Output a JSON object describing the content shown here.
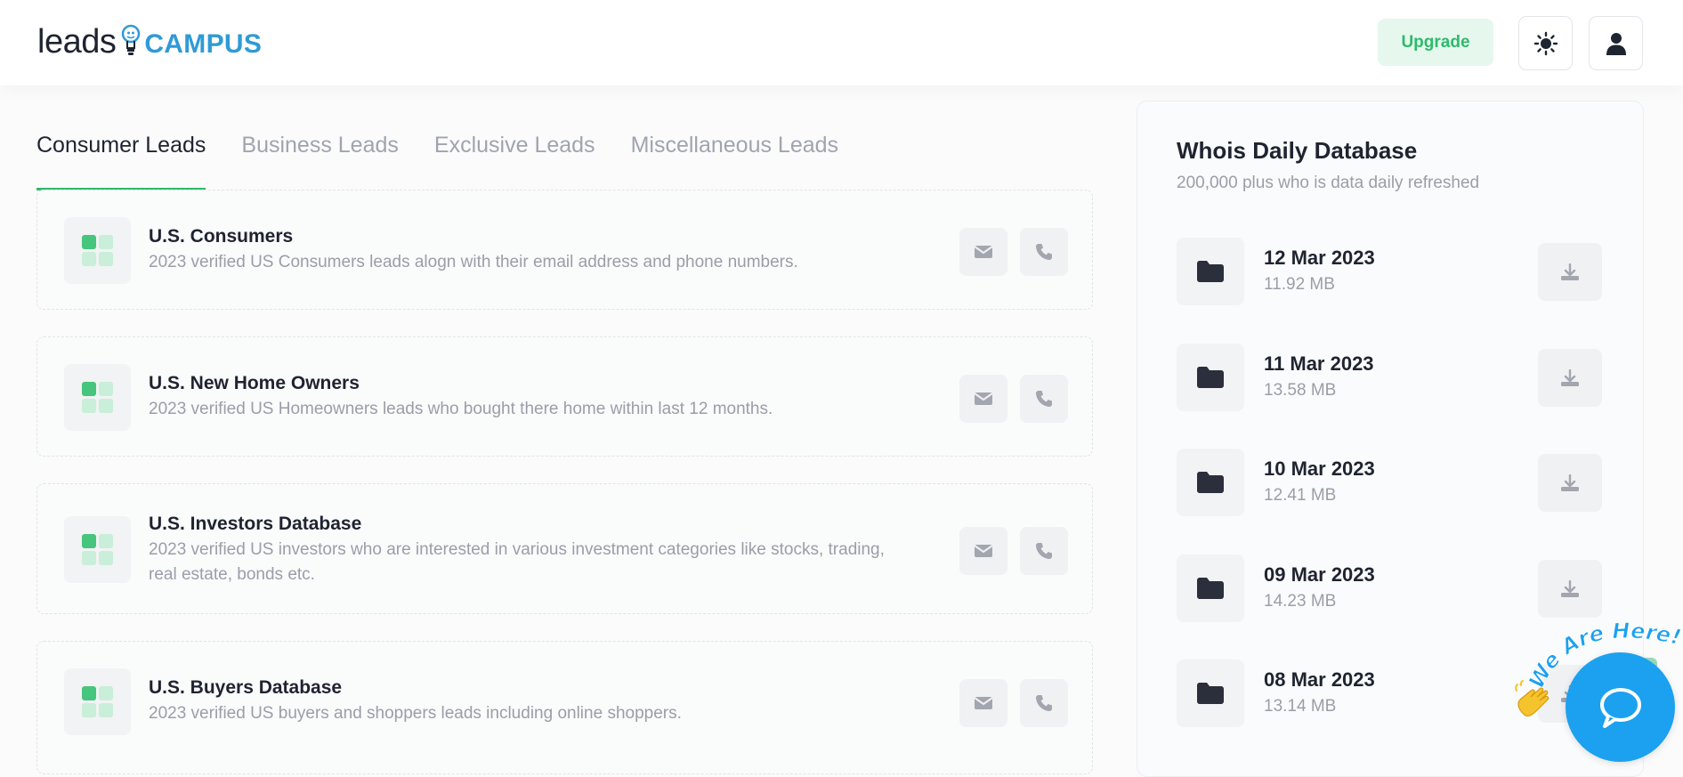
{
  "brand": {
    "logo_part1": "leads",
    "logo_part2": "CAMPUS"
  },
  "header": {
    "upgrade_label": "Upgrade",
    "theme_icon": "sun-icon",
    "user_icon": "user-icon"
  },
  "tabs": [
    {
      "label": "Consumer Leads",
      "active": true
    },
    {
      "label": "Business Leads",
      "active": false
    },
    {
      "label": "Exclusive Leads",
      "active": false
    },
    {
      "label": "Miscellaneous Leads",
      "active": false
    }
  ],
  "leads": [
    {
      "title": "U.S. Consumers",
      "description": "2023 verified US Consumers leads alogn with their email address and phone numbers."
    },
    {
      "title": "U.S. New Home Owners",
      "description": "2023 verified US Homeowners leads who bought there home within last 12 months."
    },
    {
      "title": "U.S. Investors Database",
      "description": "2023 verified US investors who are interested in various investment categories like stocks, trading, real estate, bonds etc."
    },
    {
      "title": "U.S. Buyers Database",
      "description": "2023 verified US buyers and shoppers leads including online shoppers."
    }
  ],
  "whois": {
    "title": "Whois Daily Database",
    "subtitle": "200,000 plus who is data daily refreshed",
    "files": [
      {
        "date": "12 Mar 2023",
        "size": "11.92 MB"
      },
      {
        "date": "11 Mar 2023",
        "size": "13.58 MB"
      },
      {
        "date": "10 Mar 2023",
        "size": "12.41 MB"
      },
      {
        "date": "09 Mar 2023",
        "size": "14.23 MB"
      },
      {
        "date": "08 Mar 2023",
        "size": "13.14 MB"
      }
    ]
  },
  "chat": {
    "badge_text": "We Are Here!",
    "wave_icon": "waving-hand-icon",
    "chat_icon": "chat-bubble-icon"
  },
  "colors": {
    "accent_green": "#2dbb6b",
    "brand_blue": "#2f9bd6",
    "chat_blue": "#1ba1f0"
  }
}
